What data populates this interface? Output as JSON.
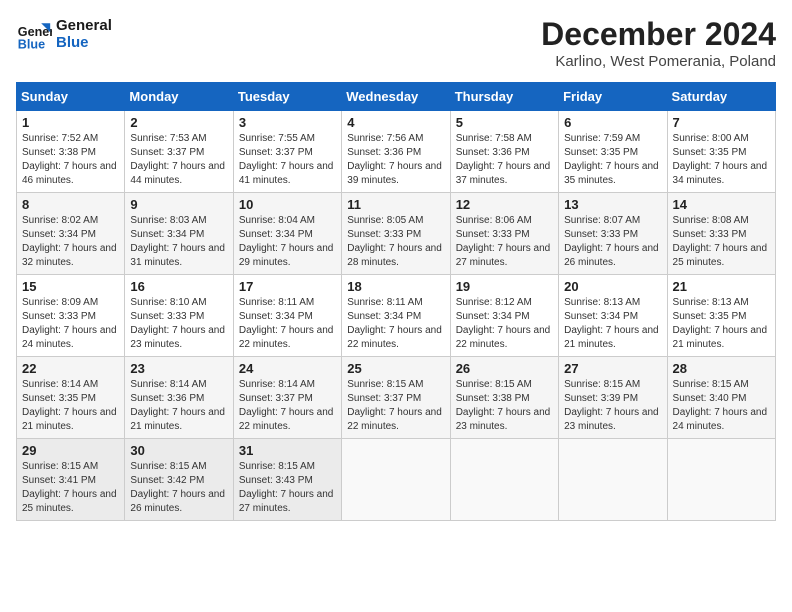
{
  "logo": {
    "line1": "General",
    "line2": "Blue"
  },
  "title": "December 2024",
  "subtitle": "Karlino, West Pomerania, Poland",
  "days_of_week": [
    "Sunday",
    "Monday",
    "Tuesday",
    "Wednesday",
    "Thursday",
    "Friday",
    "Saturday"
  ],
  "weeks": [
    [
      {
        "day": 1,
        "sunrise": "Sunrise: 7:52 AM",
        "sunset": "Sunset: 3:38 PM",
        "daylight": "Daylight: 7 hours and 46 minutes."
      },
      {
        "day": 2,
        "sunrise": "Sunrise: 7:53 AM",
        "sunset": "Sunset: 3:37 PM",
        "daylight": "Daylight: 7 hours and 44 minutes."
      },
      {
        "day": 3,
        "sunrise": "Sunrise: 7:55 AM",
        "sunset": "Sunset: 3:37 PM",
        "daylight": "Daylight: 7 hours and 41 minutes."
      },
      {
        "day": 4,
        "sunrise": "Sunrise: 7:56 AM",
        "sunset": "Sunset: 3:36 PM",
        "daylight": "Daylight: 7 hours and 39 minutes."
      },
      {
        "day": 5,
        "sunrise": "Sunrise: 7:58 AM",
        "sunset": "Sunset: 3:36 PM",
        "daylight": "Daylight: 7 hours and 37 minutes."
      },
      {
        "day": 6,
        "sunrise": "Sunrise: 7:59 AM",
        "sunset": "Sunset: 3:35 PM",
        "daylight": "Daylight: 7 hours and 35 minutes."
      },
      {
        "day": 7,
        "sunrise": "Sunrise: 8:00 AM",
        "sunset": "Sunset: 3:35 PM",
        "daylight": "Daylight: 7 hours and 34 minutes."
      }
    ],
    [
      {
        "day": 8,
        "sunrise": "Sunrise: 8:02 AM",
        "sunset": "Sunset: 3:34 PM",
        "daylight": "Daylight: 7 hours and 32 minutes."
      },
      {
        "day": 9,
        "sunrise": "Sunrise: 8:03 AM",
        "sunset": "Sunset: 3:34 PM",
        "daylight": "Daylight: 7 hours and 31 minutes."
      },
      {
        "day": 10,
        "sunrise": "Sunrise: 8:04 AM",
        "sunset": "Sunset: 3:34 PM",
        "daylight": "Daylight: 7 hours and 29 minutes."
      },
      {
        "day": 11,
        "sunrise": "Sunrise: 8:05 AM",
        "sunset": "Sunset: 3:33 PM",
        "daylight": "Daylight: 7 hours and 28 minutes."
      },
      {
        "day": 12,
        "sunrise": "Sunrise: 8:06 AM",
        "sunset": "Sunset: 3:33 PM",
        "daylight": "Daylight: 7 hours and 27 minutes."
      },
      {
        "day": 13,
        "sunrise": "Sunrise: 8:07 AM",
        "sunset": "Sunset: 3:33 PM",
        "daylight": "Daylight: 7 hours and 26 minutes."
      },
      {
        "day": 14,
        "sunrise": "Sunrise: 8:08 AM",
        "sunset": "Sunset: 3:33 PM",
        "daylight": "Daylight: 7 hours and 25 minutes."
      }
    ],
    [
      {
        "day": 15,
        "sunrise": "Sunrise: 8:09 AM",
        "sunset": "Sunset: 3:33 PM",
        "daylight": "Daylight: 7 hours and 24 minutes."
      },
      {
        "day": 16,
        "sunrise": "Sunrise: 8:10 AM",
        "sunset": "Sunset: 3:33 PM",
        "daylight": "Daylight: 7 hours and 23 minutes."
      },
      {
        "day": 17,
        "sunrise": "Sunrise: 8:11 AM",
        "sunset": "Sunset: 3:34 PM",
        "daylight": "Daylight: 7 hours and 22 minutes."
      },
      {
        "day": 18,
        "sunrise": "Sunrise: 8:11 AM",
        "sunset": "Sunset: 3:34 PM",
        "daylight": "Daylight: 7 hours and 22 minutes."
      },
      {
        "day": 19,
        "sunrise": "Sunrise: 8:12 AM",
        "sunset": "Sunset: 3:34 PM",
        "daylight": "Daylight: 7 hours and 22 minutes."
      },
      {
        "day": 20,
        "sunrise": "Sunrise: 8:13 AM",
        "sunset": "Sunset: 3:34 PM",
        "daylight": "Daylight: 7 hours and 21 minutes."
      },
      {
        "day": 21,
        "sunrise": "Sunrise: 8:13 AM",
        "sunset": "Sunset: 3:35 PM",
        "daylight": "Daylight: 7 hours and 21 minutes."
      }
    ],
    [
      {
        "day": 22,
        "sunrise": "Sunrise: 8:14 AM",
        "sunset": "Sunset: 3:35 PM",
        "daylight": "Daylight: 7 hours and 21 minutes."
      },
      {
        "day": 23,
        "sunrise": "Sunrise: 8:14 AM",
        "sunset": "Sunset: 3:36 PM",
        "daylight": "Daylight: 7 hours and 21 minutes."
      },
      {
        "day": 24,
        "sunrise": "Sunrise: 8:14 AM",
        "sunset": "Sunset: 3:37 PM",
        "daylight": "Daylight: 7 hours and 22 minutes."
      },
      {
        "day": 25,
        "sunrise": "Sunrise: 8:15 AM",
        "sunset": "Sunset: 3:37 PM",
        "daylight": "Daylight: 7 hours and 22 minutes."
      },
      {
        "day": 26,
        "sunrise": "Sunrise: 8:15 AM",
        "sunset": "Sunset: 3:38 PM",
        "daylight": "Daylight: 7 hours and 23 minutes."
      },
      {
        "day": 27,
        "sunrise": "Sunrise: 8:15 AM",
        "sunset": "Sunset: 3:39 PM",
        "daylight": "Daylight: 7 hours and 23 minutes."
      },
      {
        "day": 28,
        "sunrise": "Sunrise: 8:15 AM",
        "sunset": "Sunset: 3:40 PM",
        "daylight": "Daylight: 7 hours and 24 minutes."
      }
    ],
    [
      {
        "day": 29,
        "sunrise": "Sunrise: 8:15 AM",
        "sunset": "Sunset: 3:41 PM",
        "daylight": "Daylight: 7 hours and 25 minutes."
      },
      {
        "day": 30,
        "sunrise": "Sunrise: 8:15 AM",
        "sunset": "Sunset: 3:42 PM",
        "daylight": "Daylight: 7 hours and 26 minutes."
      },
      {
        "day": 31,
        "sunrise": "Sunrise: 8:15 AM",
        "sunset": "Sunset: 3:43 PM",
        "daylight": "Daylight: 7 hours and 27 minutes."
      },
      null,
      null,
      null,
      null
    ]
  ]
}
